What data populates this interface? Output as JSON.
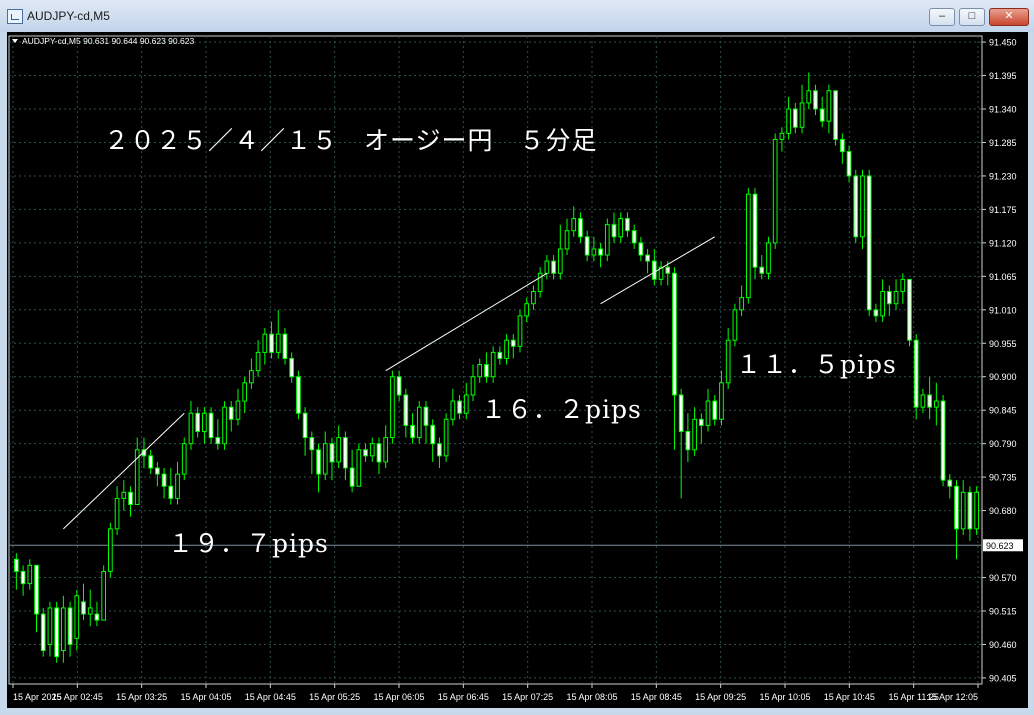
{
  "window": {
    "title": "AUDJPY-cd,M5",
    "buttons": [
      "minimize",
      "maximize",
      "close"
    ]
  },
  "chart_info": "AUDJPY-cd,M5  90.631 90.644 90.623 90.623",
  "colors": {
    "background": "#000000",
    "candle": "#00ff00",
    "grid": "#2f4f4f",
    "axis_text": "#ffffff"
  },
  "annotations": {
    "title": "２０２５／４／１５　オージー円　５分足",
    "move1": "１９．７pips",
    "move2": "１６．２pips",
    "move3": "１１．５pips"
  },
  "chart_data": {
    "type": "candlestick",
    "symbol": "AUDJPY-cd",
    "timeframe": "M5",
    "date": "15 Apr 2025",
    "current_price": 90.623,
    "y_ticks": [
      "91.450",
      "91.395",
      "91.340",
      "91.285",
      "91.230",
      "91.175",
      "91.120",
      "91.065",
      "91.010",
      "90.955",
      "90.900",
      "90.845",
      "90.790",
      "90.735",
      "90.680",
      "90.623",
      "90.570",
      "90.515",
      "90.460",
      "90.405"
    ],
    "x_ticks": [
      "15 Apr 2025",
      "15 Apr 02:45",
      "15 Apr 03:25",
      "15 Apr 04:05",
      "15 Apr 04:45",
      "15 Apr 05:25",
      "15 Apr 06:05",
      "15 Apr 06:45",
      "15 Apr 07:25",
      "15 Apr 08:05",
      "15 Apr 08:45",
      "15 Apr 09:25",
      "15 Apr 10:05",
      "15 Apr 10:45",
      "15 Apr 11:25",
      "15 Apr 12:05"
    ],
    "ylim": [
      90.395,
      91.46
    ],
    "candles": [
      [
        90.6,
        90.58,
        90.61,
        90.55
      ],
      [
        90.58,
        90.56,
        90.59,
        90.54
      ],
      [
        90.56,
        90.59,
        90.6,
        90.55
      ],
      [
        90.59,
        90.51,
        90.59,
        90.48
      ],
      [
        90.51,
        90.45,
        90.52,
        90.44
      ],
      [
        90.46,
        90.52,
        90.53,
        90.44
      ],
      [
        90.52,
        90.44,
        90.53,
        90.43
      ],
      [
        90.45,
        90.52,
        90.54,
        90.43
      ],
      [
        90.52,
        90.46,
        90.53,
        90.44
      ],
      [
        90.47,
        90.54,
        90.55,
        90.45
      ],
      [
        90.53,
        90.51,
        90.56,
        90.5
      ],
      [
        90.51,
        90.52,
        90.55,
        90.49
      ],
      [
        90.51,
        90.5,
        90.53,
        90.49
      ],
      [
        90.5,
        90.58,
        90.59,
        90.5
      ],
      [
        90.58,
        90.65,
        90.66,
        90.57
      ],
      [
        90.65,
        90.7,
        90.72,
        90.64
      ],
      [
        90.7,
        90.71,
        90.73,
        90.68
      ],
      [
        90.71,
        90.69,
        90.72,
        90.67
      ],
      [
        90.69,
        90.78,
        90.8,
        90.69
      ],
      [
        90.78,
        90.77,
        90.8,
        90.75
      ],
      [
        90.77,
        90.75,
        90.78,
        90.74
      ],
      [
        90.75,
        90.74,
        90.76,
        90.72
      ],
      [
        90.74,
        90.72,
        90.75,
        90.7
      ],
      [
        90.72,
        90.7,
        90.75,
        90.69
      ],
      [
        90.7,
        90.74,
        90.76,
        90.69
      ],
      [
        90.74,
        90.79,
        90.8,
        90.73
      ],
      [
        90.79,
        90.84,
        90.86,
        90.78
      ],
      [
        90.84,
        90.81,
        90.85,
        90.8
      ],
      [
        90.81,
        90.84,
        90.85,
        90.79
      ],
      [
        90.84,
        90.8,
        90.85,
        90.79
      ],
      [
        90.8,
        90.79,
        90.83,
        90.78
      ],
      [
        90.79,
        90.85,
        90.86,
        90.78
      ],
      [
        90.85,
        90.83,
        90.86,
        90.81
      ],
      [
        90.83,
        90.86,
        90.88,
        90.82
      ],
      [
        90.86,
        90.89,
        90.9,
        90.84
      ],
      [
        90.89,
        90.91,
        90.93,
        90.88
      ],
      [
        90.91,
        90.94,
        90.96,
        90.9
      ],
      [
        90.94,
        90.97,
        90.98,
        90.92
      ],
      [
        90.97,
        90.94,
        90.99,
        90.93
      ],
      [
        90.94,
        90.97,
        91.01,
        90.93
      ],
      [
        90.97,
        90.93,
        90.98,
        90.92
      ],
      [
        90.93,
        90.9,
        90.94,
        90.89
      ],
      [
        90.9,
        90.84,
        90.91,
        90.83
      ],
      [
        90.84,
        90.8,
        90.85,
        90.77
      ],
      [
        90.8,
        90.78,
        90.81,
        90.74
      ],
      [
        90.78,
        90.74,
        90.79,
        90.71
      ],
      [
        90.74,
        90.79,
        90.81,
        90.73
      ],
      [
        90.79,
        90.76,
        90.8,
        90.73
      ],
      [
        90.76,
        90.8,
        90.82,
        90.75
      ],
      [
        90.8,
        90.75,
        90.81,
        90.73
      ],
      [
        90.75,
        90.72,
        90.78,
        90.71
      ],
      [
        90.72,
        90.78,
        90.79,
        90.72
      ],
      [
        90.78,
        90.77,
        90.79,
        90.76
      ],
      [
        90.77,
        90.79,
        90.8,
        90.76
      ],
      [
        90.79,
        90.76,
        90.8,
        90.74
      ],
      [
        90.76,
        90.8,
        90.82,
        90.75
      ],
      [
        90.8,
        90.9,
        90.91,
        90.79
      ],
      [
        90.9,
        90.87,
        90.91,
        90.86
      ],
      [
        90.87,
        90.82,
        90.88,
        90.8
      ],
      [
        90.82,
        90.8,
        90.84,
        90.79
      ],
      [
        90.8,
        90.85,
        90.86,
        90.79
      ],
      [
        90.85,
        90.82,
        90.86,
        90.79
      ],
      [
        90.82,
        90.79,
        90.83,
        90.76
      ],
      [
        90.79,
        90.77,
        90.8,
        90.75
      ],
      [
        90.77,
        90.83,
        90.84,
        90.76
      ],
      [
        90.83,
        90.86,
        90.88,
        90.82
      ],
      [
        90.86,
        90.84,
        90.87,
        90.83
      ],
      [
        90.84,
        90.87,
        90.89,
        90.83
      ],
      [
        90.87,
        90.9,
        90.92,
        90.86
      ],
      [
        90.9,
        90.92,
        90.93,
        90.89
      ],
      [
        90.92,
        90.9,
        90.94,
        90.89
      ],
      [
        90.9,
        90.94,
        90.95,
        90.89
      ],
      [
        90.94,
        90.93,
        90.95,
        90.92
      ],
      [
        90.93,
        90.96,
        90.97,
        90.92
      ],
      [
        90.96,
        90.95,
        90.97,
        90.93
      ],
      [
        90.95,
        91.0,
        91.01,
        90.94
      ],
      [
        91.0,
        91.02,
        91.03,
        90.99
      ],
      [
        91.02,
        91.04,
        91.05,
        91.01
      ],
      [
        91.04,
        91.07,
        91.08,
        91.03
      ],
      [
        91.07,
        91.09,
        91.1,
        91.06
      ],
      [
        91.09,
        91.07,
        91.1,
        91.06
      ],
      [
        91.07,
        91.11,
        91.15,
        91.06
      ],
      [
        91.11,
        91.14,
        91.16,
        91.1
      ],
      [
        91.14,
        91.16,
        91.18,
        91.13
      ],
      [
        91.16,
        91.13,
        91.17,
        91.12
      ],
      [
        91.13,
        91.1,
        91.14,
        91.09
      ],
      [
        91.1,
        91.11,
        91.13,
        91.09
      ],
      [
        91.11,
        91.1,
        91.12,
        91.08
      ],
      [
        91.1,
        91.15,
        91.16,
        91.09
      ],
      [
        91.15,
        91.13,
        91.17,
        91.12
      ],
      [
        91.13,
        91.16,
        91.17,
        91.12
      ],
      [
        91.16,
        91.14,
        91.17,
        91.13
      ],
      [
        91.14,
        91.12,
        91.15,
        91.11
      ],
      [
        91.12,
        91.1,
        91.13,
        91.09
      ],
      [
        91.1,
        91.09,
        91.11,
        91.07
      ],
      [
        91.09,
        91.06,
        91.11,
        91.05
      ],
      [
        91.06,
        91.08,
        91.09,
        91.05
      ],
      [
        91.08,
        91.07,
        91.09,
        91.05
      ],
      [
        91.07,
        90.87,
        91.08,
        90.78
      ],
      [
        90.87,
        90.81,
        90.88,
        90.7
      ],
      [
        90.81,
        90.78,
        90.84,
        90.76
      ],
      [
        90.78,
        90.83,
        90.85,
        90.77
      ],
      [
        90.83,
        90.82,
        90.84,
        90.79
      ],
      [
        90.82,
        90.86,
        90.88,
        90.81
      ],
      [
        90.86,
        90.83,
        90.87,
        90.82
      ],
      [
        90.83,
        90.89,
        90.91,
        90.82
      ],
      [
        90.89,
        90.96,
        90.98,
        90.88
      ],
      [
        90.96,
        91.01,
        91.02,
        90.95
      ],
      [
        91.01,
        91.03,
        91.05,
        91.0
      ],
      [
        91.03,
        91.2,
        91.21,
        91.02
      ],
      [
        91.2,
        91.08,
        91.21,
        91.06
      ],
      [
        91.08,
        91.07,
        91.1,
        91.06
      ],
      [
        91.07,
        91.12,
        91.13,
        91.06
      ],
      [
        91.12,
        91.29,
        91.3,
        91.11
      ],
      [
        91.29,
        91.3,
        91.31,
        91.27
      ],
      [
        91.3,
        91.34,
        91.36,
        91.29
      ],
      [
        91.34,
        91.31,
        91.35,
        91.3
      ],
      [
        91.31,
        91.35,
        91.38,
        91.3
      ],
      [
        91.35,
        91.37,
        91.4,
        91.34
      ],
      [
        91.37,
        91.34,
        91.38,
        91.33
      ],
      [
        91.34,
        91.32,
        91.36,
        91.31
      ],
      [
        91.32,
        91.37,
        91.38,
        91.3
      ],
      [
        91.37,
        91.29,
        91.37,
        91.28
      ],
      [
        91.29,
        91.27,
        91.3,
        91.25
      ],
      [
        91.27,
        91.23,
        91.28,
        91.22
      ],
      [
        91.23,
        91.13,
        91.24,
        91.12
      ],
      [
        91.13,
        91.23,
        91.24,
        91.11
      ],
      [
        91.23,
        91.01,
        91.24,
        91.0
      ],
      [
        91.01,
        91.0,
        91.02,
        90.99
      ],
      [
        91.0,
        91.04,
        91.06,
        90.99
      ],
      [
        91.04,
        91.02,
        91.05,
        91.0
      ],
      [
        91.02,
        91.04,
        91.06,
        91.01
      ],
      [
        91.04,
        91.06,
        91.07,
        91.02
      ],
      [
        91.06,
        90.96,
        91.06,
        90.95
      ],
      [
        90.96,
        90.85,
        90.97,
        90.83
      ],
      [
        90.85,
        90.87,
        90.88,
        90.84
      ],
      [
        90.87,
        90.85,
        90.9,
        90.83
      ],
      [
        90.85,
        90.86,
        90.89,
        90.82
      ],
      [
        90.86,
        90.73,
        90.87,
        90.72
      ],
      [
        90.73,
        90.72,
        90.74,
        90.7
      ],
      [
        90.72,
        90.65,
        90.73,
        90.6
      ],
      [
        90.65,
        90.71,
        90.73,
        90.64
      ],
      [
        90.71,
        90.65,
        90.72,
        90.63
      ],
      [
        90.65,
        90.71,
        90.72,
        90.64
      ]
    ],
    "trendlines": [
      {
        "from": {
          "time": "15 Apr 02:40",
          "price": 90.65
        },
        "to": {
          "time": "15 Apr 04:10",
          "price": 90.84
        },
        "label": "１９．７pips"
      },
      {
        "from": {
          "time": "15 Apr 06:40",
          "price": 90.91
        },
        "to": {
          "time": "15 Apr 08:40",
          "price": 91.07
        },
        "label": "１６．２pips"
      },
      {
        "from": {
          "time": "15 Apr 09:20",
          "price": 91.02
        },
        "to": {
          "time": "15 Apr 10:45",
          "price": 91.13
        },
        "label": "１１．５pips"
      }
    ],
    "grid": true,
    "legend": "none"
  }
}
